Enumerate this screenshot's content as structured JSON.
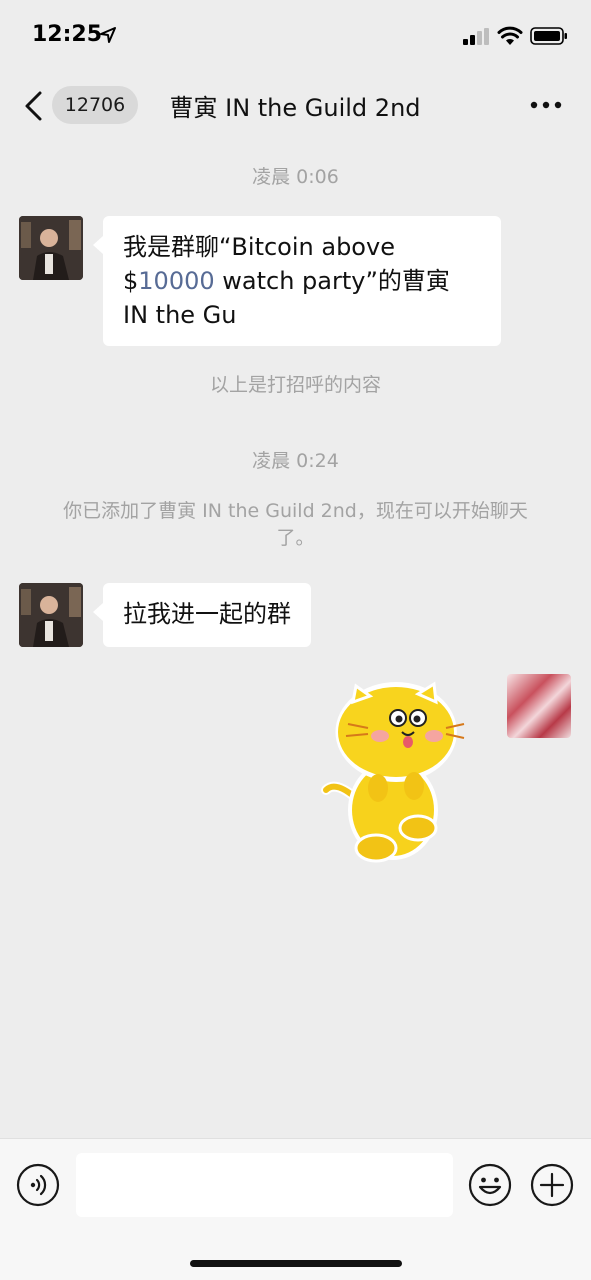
{
  "status_bar": {
    "time": "12:25"
  },
  "nav": {
    "unread_count": "12706",
    "title": "曹寅 IN the Guild 2nd"
  },
  "messages": [
    {
      "type": "timestamp",
      "text": "凌晨 0:06"
    },
    {
      "type": "incoming_text",
      "text_part1": "我是群聊“Bitcoin above $",
      "text_link": "10000",
      "text_part2": " watch party”的曹寅 IN the Gu"
    },
    {
      "type": "system",
      "text": "以上是打招呼的内容"
    },
    {
      "type": "timestamp",
      "text": "凌晨 0:24"
    },
    {
      "type": "system",
      "text": "你已添加了曹寅 IN the Guild 2nd，现在可以开始聊天了。"
    },
    {
      "type": "incoming_text",
      "text": "拉我进一起的群"
    },
    {
      "type": "outgoing_sticker",
      "sticker": "yellow-cat-sticker"
    }
  ],
  "colors": {
    "background": "#ededed",
    "bubble": "#ffffff",
    "link": "#576b95",
    "system_text": "#a3a3a3"
  },
  "icons": [
    "location-arrow-icon",
    "signal-icon",
    "wifi-icon",
    "battery-icon",
    "back-chevron-icon",
    "more-dots-icon",
    "voice-icon",
    "emoji-icon",
    "plus-icon"
  ]
}
